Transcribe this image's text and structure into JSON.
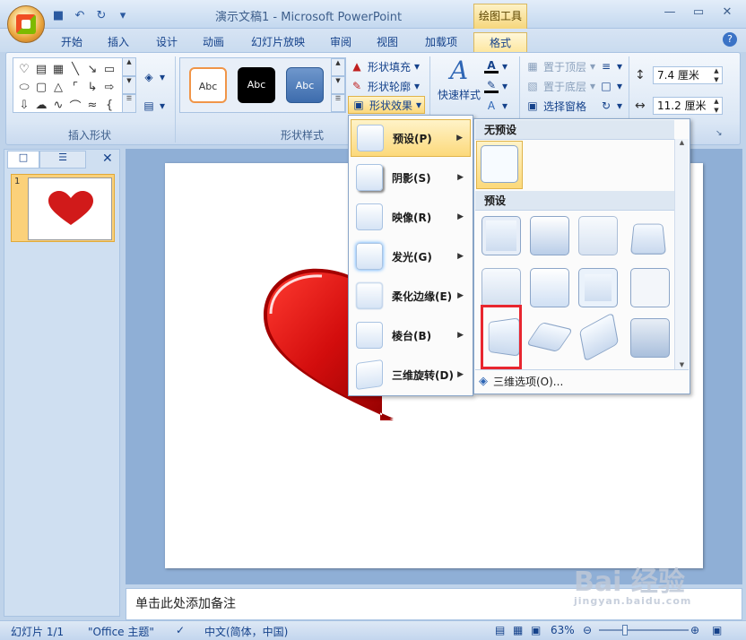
{
  "window": {
    "title": "演示文稿1 - Microsoft PowerPoint",
    "context_tab": "绘图工具",
    "controls": [
      "minimize-icon",
      "maximize-icon",
      "close-icon"
    ]
  },
  "tabs": [
    "开始",
    "插入",
    "设计",
    "动画",
    "幻灯片放映",
    "审阅",
    "视图",
    "加载项",
    "格式"
  ],
  "active_tab": "格式",
  "ribbon": {
    "groups": {
      "insert_shapes": "插入形状",
      "shape_styles": "形状样式"
    },
    "style_samples": [
      "Abc",
      "Abc",
      "Abc"
    ],
    "fill_label": "形状填充",
    "outline_label": "形状轮廓",
    "effects_label": "形状效果",
    "quick_styles": "快速样式",
    "bring_front": "置于顶层",
    "send_back": "置于底层",
    "selection_pane": "选择窗格",
    "height": "7.4 厘米",
    "width": "11.2 厘米"
  },
  "effects_menu": [
    {
      "label": "预设(P)",
      "highlight": true
    },
    {
      "label": "阴影(S)"
    },
    {
      "label": "映像(R)"
    },
    {
      "label": "发光(G)"
    },
    {
      "label": "柔化边缘(E)"
    },
    {
      "label": "棱台(B)"
    },
    {
      "label": "三维旋转(D)"
    }
  ],
  "preset_submenu": {
    "no_preset": "无预设",
    "presets": "预设",
    "footer": "三维选项(O)..."
  },
  "slide_panel": {
    "slide_number": "1"
  },
  "notes_placeholder": "单击此处添加备注",
  "status": {
    "slide": "幻灯片 1/1",
    "theme": "\"Office 主题\"",
    "language": "中文(简体，中国)",
    "zoom": "63%"
  },
  "watermark": {
    "brand": "Bai 经验",
    "url": "jingyan.baidu.com"
  }
}
